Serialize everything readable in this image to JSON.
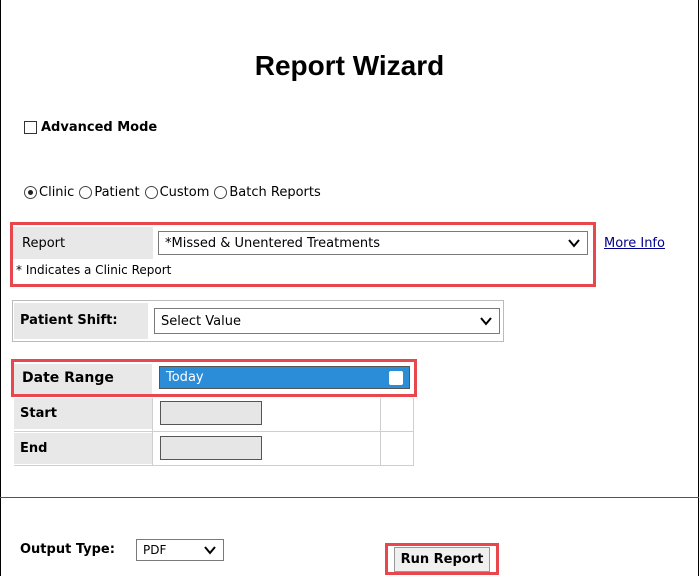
{
  "title": "Report Wizard",
  "advanced_mode": {
    "label": "Advanced Mode",
    "checked": false
  },
  "report_types": [
    {
      "label": "Clinic",
      "selected": true
    },
    {
      "label": "Patient",
      "selected": false
    },
    {
      "label": "Custom",
      "selected": false
    },
    {
      "label": "Batch Reports",
      "selected": false
    }
  ],
  "report": {
    "label": "Report",
    "value": "*Missed & Unentered Treatments",
    "note": "* Indicates a Clinic Report",
    "more_info": "More Info"
  },
  "patient_shift": {
    "label": "Patient Shift:",
    "value": "Select Value"
  },
  "date_range": {
    "label": "Date Range",
    "value": "Today",
    "start_label": "Start",
    "end_label": "End"
  },
  "output": {
    "label": "Output Type:",
    "value": "PDF"
  },
  "run_button": "Run Report",
  "colors": {
    "highlight": "#e8474d",
    "selected_blue": "#2b8cd8",
    "link": "#00008b"
  }
}
